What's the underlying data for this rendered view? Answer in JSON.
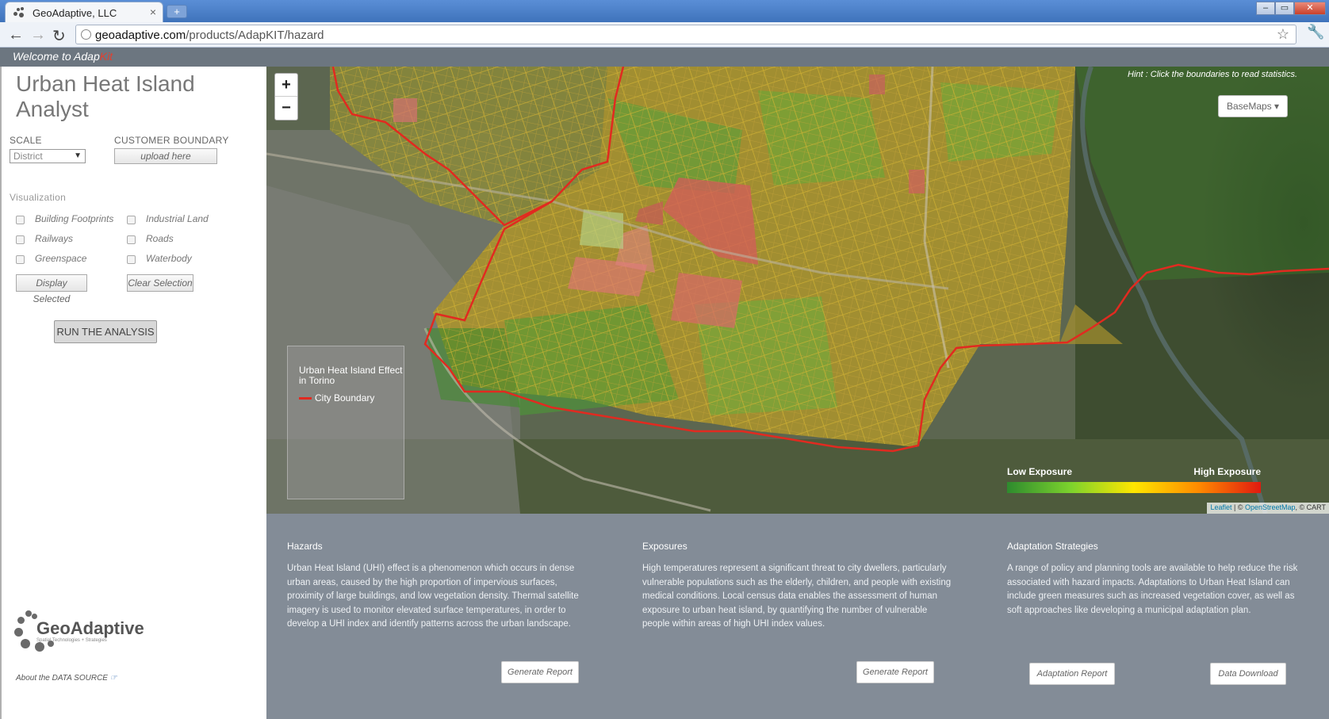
{
  "browser": {
    "tab_title": "GeoAdaptive, LLC",
    "tab_close": "×",
    "new_tab": "+",
    "url_domain": "geoadaptive.com",
    "url_path": "/products/AdapKIT/hazard",
    "win_minimize": "‒",
    "win_maximize": "▭",
    "win_close": "✕"
  },
  "header": {
    "welcome_prefix": "Welcome to Adap",
    "welcome_kit": "Kit"
  },
  "sidebar": {
    "title": "Urban Heat Island Analyst",
    "scale_label": "SCALE",
    "scale_value": "District",
    "customer_boundary_label": "CUSTOMER BOUNDARY",
    "upload_button": "upload here",
    "visualization_label": "Visualization",
    "layers": [
      {
        "label": "Building Footprints"
      },
      {
        "label": "Industrial Land"
      },
      {
        "label": "Railways"
      },
      {
        "label": "Roads"
      },
      {
        "label": "Greenspace"
      },
      {
        "label": "Waterbody"
      }
    ],
    "display_selected_button": "Display Selected",
    "clear_selection_button": "Clear Selection",
    "run_button": "RUN THE ANALYSIS",
    "logo_name": "GeoAdaptive",
    "logo_tagline": "Spatial Technologies + Strategies",
    "about_link": "About the DATA SOURCE"
  },
  "map": {
    "zoom_in": "+",
    "zoom_out": "−",
    "hint": "Hint : Click the boundaries to read statistics.",
    "basemaps_button": "BaseMaps ▾",
    "legend_title": "Urban Heat Island Effect in Torino",
    "legend_city_boundary": "City Boundary",
    "low_exposure": "Low Exposure",
    "high_exposure": "High Exposure",
    "attribution_leaflet": "Leaflet",
    "attribution_rest": "| © ",
    "attribution_osm": "OpenStreetMap",
    "attribution_carto": ", © CART",
    "colors": {
      "city_boundary": "#e12a20",
      "low": "#2e8b2e",
      "high": "#e01a10"
    }
  },
  "info": {
    "hazards": {
      "title": "Hazards",
      "text": "Urban Heat Island (UHI) effect is a phenomenon which occurs in dense urban areas, caused by the high proportion of impervious surfaces, proximity of large buildings, and low vegetation density. Thermal satellite imagery is used to monitor elevated surface temperatures, in order to develop a UHI index and identify patterns across the urban landscape.",
      "button": "Generate Report"
    },
    "exposures": {
      "title": "Exposures",
      "text": "High temperatures represent a significant threat to city dwellers, particularly vulnerable populations such as the elderly, children, and people with existing medical conditions. Local census data enables the assessment of human exposure to urban heat island, by quantifying the number of vulnerable people within areas of high UHI index values.",
      "button": "Generate Report"
    },
    "adaptation": {
      "title": "Adaptation Strategies",
      "text": "A range of policy and planning tools are available to help reduce the risk associated with hazard impacts. Adaptations to Urban Heat Island can include green measures such as increased vegetation cover, as well as soft approaches like developing a municipal adaptation plan.",
      "button_report": "Adaptation Report",
      "button_download": "Data Download"
    }
  }
}
